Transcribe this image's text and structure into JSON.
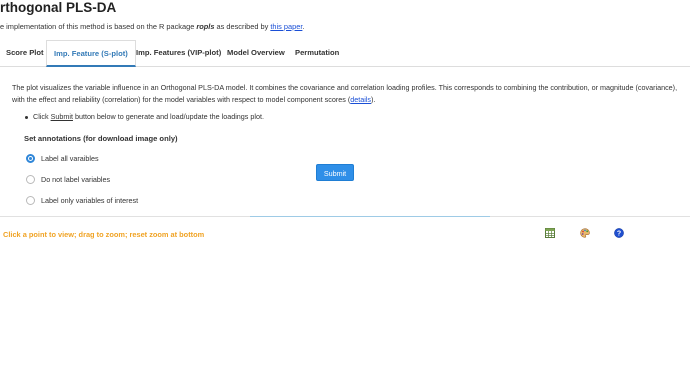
{
  "header": {
    "title": "rthogonal PLS-DA",
    "intro_prefix": "e implementation of this method is based on the R package ",
    "intro_pkg": "ropls",
    "intro_mid": " as described by ",
    "intro_link": "this paper",
    "intro_suffix": "."
  },
  "tabs": [
    {
      "label": "Score Plot",
      "active": false
    },
    {
      "label": "Imp. Feature (S-plot)",
      "active": true
    },
    {
      "label": "Imp. Features (VIP-plot)",
      "active": false
    },
    {
      "label": "Model Overview",
      "active": false
    },
    {
      "label": "Permutation",
      "active": false
    }
  ],
  "panel": {
    "description": "The plot visualizes the variable influence in an Orthogonal PLS-DA model. It combines the covariance and correlation loading profiles. This corresponds to combining the contribution, or magnitude (covariance), with the effect and reliability (correlation) for the model variables with respect to model component scores (",
    "details_link": "details",
    "description_end": ").",
    "bullet_prefix": "Click ",
    "bullet_link": "Submit",
    "bullet_suffix": " button below to generate and load/update the loadings plot."
  },
  "annotations": {
    "heading": "Set annotations (for download image only)",
    "options": [
      {
        "label": "Label all varaibles",
        "checked": true
      },
      {
        "label": "Do not label variables",
        "checked": false
      },
      {
        "label": "Label only variables of interest",
        "checked": false
      }
    ]
  },
  "submit_label": "Submit",
  "hint": "Click a point to view; drag to zoom; reset zoom at bottom",
  "toolbar_icons": [
    "table-icon",
    "palette-icon",
    "help-icon"
  ],
  "colors": {
    "accent": "#337ab7",
    "button": "#2f8fe8",
    "hint": "#f0a324",
    "link": "#1a4fd6"
  }
}
